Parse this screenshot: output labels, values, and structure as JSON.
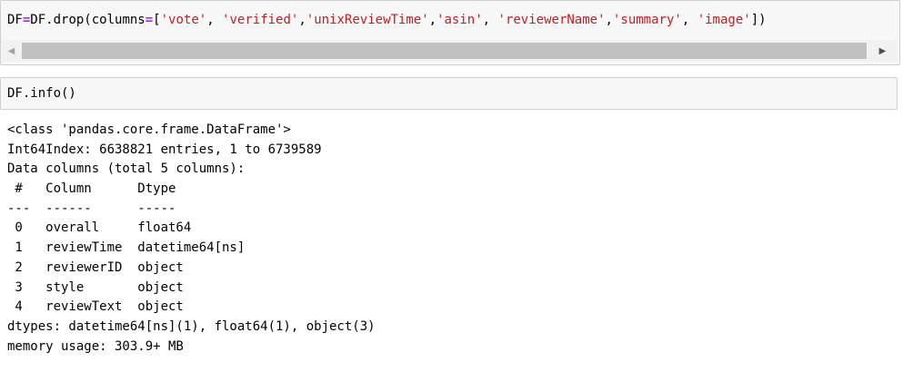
{
  "cell1": {
    "tokens": [
      {
        "t": "DF",
        "k": "punc"
      },
      {
        "t": "=",
        "k": "op"
      },
      {
        "t": "DF.drop(columns",
        "k": "punc"
      },
      {
        "t": "=",
        "k": "op"
      },
      {
        "t": "[",
        "k": "punc"
      },
      {
        "t": "'vote'",
        "k": "str"
      },
      {
        "t": ", ",
        "k": "punc"
      },
      {
        "t": "'verified'",
        "k": "str"
      },
      {
        "t": ",",
        "k": "punc"
      },
      {
        "t": "'unixReviewTime'",
        "k": "str"
      },
      {
        "t": ",",
        "k": "punc"
      },
      {
        "t": "'asin'",
        "k": "str"
      },
      {
        "t": ", ",
        "k": "punc"
      },
      {
        "t": "'reviewerName'",
        "k": "str"
      },
      {
        "t": ",",
        "k": "punc"
      },
      {
        "t": "'summary'",
        "k": "str"
      },
      {
        "t": ", ",
        "k": "punc"
      },
      {
        "t": "'image'",
        "k": "str"
      },
      {
        "t": "])",
        "k": "punc"
      }
    ]
  },
  "cell2": {
    "code": "DF.info()"
  },
  "output": {
    "lines": [
      "<class 'pandas.core.frame.DataFrame'>",
      "Int64Index: 6638821 entries, 1 to 6739589",
      "Data columns (total 5 columns):",
      " #   Column      Dtype         ",
      "---  ------      -----         ",
      " 0   overall     float64       ",
      " 1   reviewTime  datetime64[ns]",
      " 2   reviewerID  object        ",
      " 3   style       object        ",
      " 4   reviewText  object        ",
      "dtypes: datetime64[ns](1), float64(1), object(3)",
      "memory usage: 303.9+ MB"
    ]
  },
  "scrollbar": {
    "left_icon": "scroll-left-arrow-icon",
    "right_icon": "scroll-right-arrow-icon"
  }
}
